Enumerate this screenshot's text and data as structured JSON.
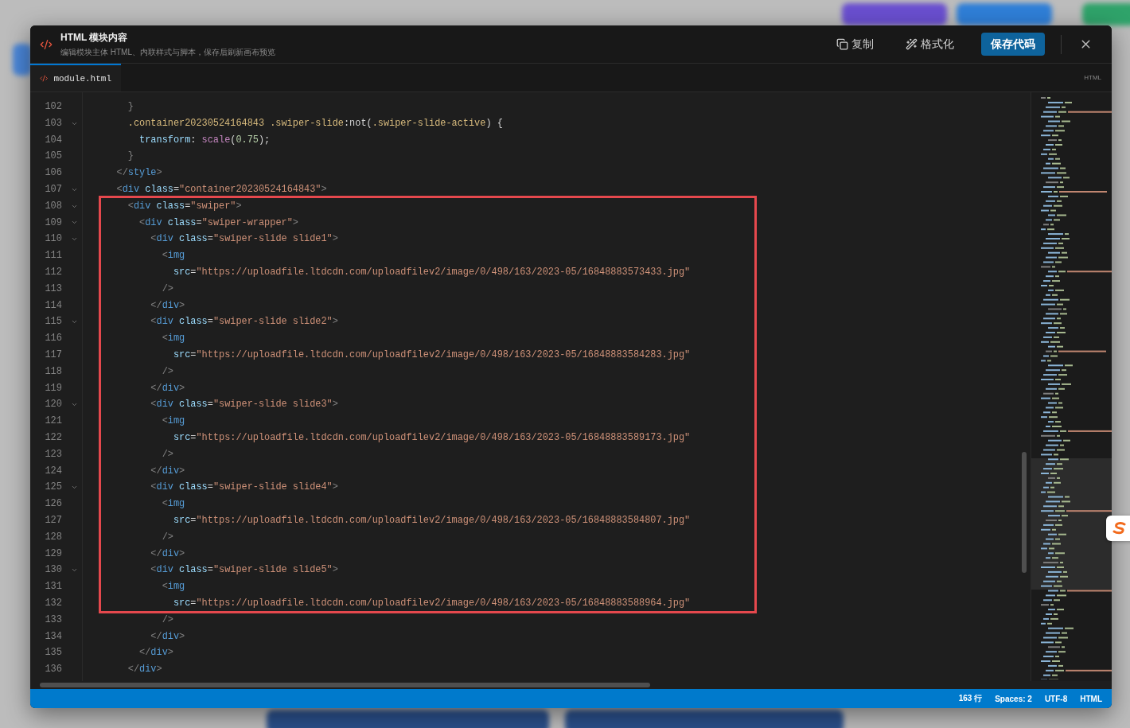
{
  "dialog": {
    "title": "HTML 模块内容",
    "subtitle": "编辑模块主体 HTML、内联样式与脚本，保存后刷新画布预览",
    "actions": [
      {
        "kind": "copy",
        "label": "复制"
      },
      {
        "kind": "format",
        "label": "格式化"
      },
      {
        "kind": "save",
        "label": "保存代码"
      }
    ]
  },
  "tabs": [
    {
      "label": "module.html",
      "selected": true
    }
  ],
  "language_badge": "HTML",
  "lines": [
    {
      "number": "102",
      "foldable": false,
      "tokens": [
        {
          "kind": "punct",
          "text": "      }"
        }
      ]
    },
    {
      "number": "103",
      "foldable": true,
      "tokens": [
        {
          "kind": "selector",
          "text": "      .container20230524164843 .swiper-slide"
        },
        {
          "kind": "text",
          "text": ":not("
        },
        {
          "kind": "selector",
          "text": ".swiper-slide-active"
        },
        {
          "kind": "text",
          "text": ") {"
        }
      ]
    },
    {
      "number": "104",
      "foldable": false,
      "tokens": [
        {
          "kind": "prop",
          "text": "        transform"
        },
        {
          "kind": "text",
          "text": ": "
        },
        {
          "kind": "func",
          "text": "scale"
        },
        {
          "kind": "text",
          "text": "("
        },
        {
          "kind": "num",
          "text": "0.75"
        },
        {
          "kind": "text",
          "text": ");"
        }
      ]
    },
    {
      "number": "105",
      "foldable": false,
      "tokens": [
        {
          "kind": "punct",
          "text": "      }"
        }
      ]
    },
    {
      "number": "106",
      "foldable": false,
      "tokens": [
        {
          "kind": "punct",
          "text": "    </"
        },
        {
          "kind": "tag",
          "text": "style"
        },
        {
          "kind": "punct",
          "text": ">"
        }
      ]
    },
    {
      "number": "107",
      "foldable": true,
      "tokens": [
        {
          "kind": "punct",
          "text": "    <"
        },
        {
          "kind": "tag",
          "text": "div"
        },
        {
          "kind": "attr",
          "text": " class"
        },
        {
          "kind": "text",
          "text": "="
        },
        {
          "kind": "str",
          "text": "\"container20230524164843\""
        },
        {
          "kind": "punct",
          "text": ">"
        }
      ]
    },
    {
      "number": "108",
      "foldable": true,
      "tokens": [
        {
          "kind": "punct",
          "text": "      <"
        },
        {
          "kind": "tag",
          "text": "div"
        },
        {
          "kind": "attr",
          "text": " class"
        },
        {
          "kind": "text",
          "text": "="
        },
        {
          "kind": "str",
          "text": "\"swiper\""
        },
        {
          "kind": "punct",
          "text": ">"
        }
      ]
    },
    {
      "number": "109",
      "foldable": true,
      "tokens": [
        {
          "kind": "punct",
          "text": "        <"
        },
        {
          "kind": "tag",
          "text": "div"
        },
        {
          "kind": "attr",
          "text": " class"
        },
        {
          "kind": "text",
          "text": "="
        },
        {
          "kind": "str",
          "text": "\"swiper-wrapper\""
        },
        {
          "kind": "punct",
          "text": ">"
        }
      ]
    },
    {
      "number": "110",
      "foldable": true,
      "tokens": [
        {
          "kind": "punct",
          "text": "          <"
        },
        {
          "kind": "tag",
          "text": "div"
        },
        {
          "kind": "attr",
          "text": " class"
        },
        {
          "kind": "text",
          "text": "="
        },
        {
          "kind": "str",
          "text": "\"swiper-slide slide1\""
        },
        {
          "kind": "punct",
          "text": ">"
        }
      ]
    },
    {
      "number": "111",
      "foldable": false,
      "tokens": [
        {
          "kind": "punct",
          "text": "            <"
        },
        {
          "kind": "tag",
          "text": "img"
        }
      ]
    },
    {
      "number": "112",
      "foldable": false,
      "tokens": [
        {
          "kind": "attr",
          "text": "              src"
        },
        {
          "kind": "text",
          "text": "="
        },
        {
          "kind": "str",
          "text": "\"https://uploadfile.ltdcdn.com/uploadfilev2/image/0/498/163/2023-05/16848883573433.jpg\""
        }
      ]
    },
    {
      "number": "113",
      "foldable": false,
      "tokens": [
        {
          "kind": "punct",
          "text": "            />"
        }
      ]
    },
    {
      "number": "114",
      "foldable": false,
      "tokens": [
        {
          "kind": "punct",
          "text": "          </"
        },
        {
          "kind": "tag",
          "text": "div"
        },
        {
          "kind": "punct",
          "text": ">"
        }
      ]
    },
    {
      "number": "115",
      "foldable": true,
      "tokens": [
        {
          "kind": "punct",
          "text": "          <"
        },
        {
          "kind": "tag",
          "text": "div"
        },
        {
          "kind": "attr",
          "text": " class"
        },
        {
          "kind": "text",
          "text": "="
        },
        {
          "kind": "str",
          "text": "\"swiper-slide slide2\""
        },
        {
          "kind": "punct",
          "text": ">"
        }
      ]
    },
    {
      "number": "116",
      "foldable": false,
      "tokens": [
        {
          "kind": "punct",
          "text": "            <"
        },
        {
          "kind": "tag",
          "text": "img"
        }
      ]
    },
    {
      "number": "117",
      "foldable": false,
      "tokens": [
        {
          "kind": "attr",
          "text": "              src"
        },
        {
          "kind": "text",
          "text": "="
        },
        {
          "kind": "str",
          "text": "\"https://uploadfile.ltdcdn.com/uploadfilev2/image/0/498/163/2023-05/16848883584283.jpg\""
        }
      ]
    },
    {
      "number": "118",
      "foldable": false,
      "tokens": [
        {
          "kind": "punct",
          "text": "            />"
        }
      ]
    },
    {
      "number": "119",
      "foldable": false,
      "tokens": [
        {
          "kind": "punct",
          "text": "          </"
        },
        {
          "kind": "tag",
          "text": "div"
        },
        {
          "kind": "punct",
          "text": ">"
        }
      ]
    },
    {
      "number": "120",
      "foldable": true,
      "tokens": [
        {
          "kind": "punct",
          "text": "          <"
        },
        {
          "kind": "tag",
          "text": "div"
        },
        {
          "kind": "attr",
          "text": " class"
        },
        {
          "kind": "text",
          "text": "="
        },
        {
          "kind": "str",
          "text": "\"swiper-slide slide3\""
        },
        {
          "kind": "punct",
          "text": ">"
        }
      ]
    },
    {
      "number": "121",
      "foldable": false,
      "tokens": [
        {
          "kind": "punct",
          "text": "            <"
        },
        {
          "kind": "tag",
          "text": "img"
        }
      ]
    },
    {
      "number": "122",
      "foldable": false,
      "tokens": [
        {
          "kind": "attr",
          "text": "              src"
        },
        {
          "kind": "text",
          "text": "="
        },
        {
          "kind": "str",
          "text": "\"https://uploadfile.ltdcdn.com/uploadfilev2/image/0/498/163/2023-05/16848883589173.jpg\""
        }
      ]
    },
    {
      "number": "123",
      "foldable": false,
      "tokens": [
        {
          "kind": "punct",
          "text": "            />"
        }
      ]
    },
    {
      "number": "124",
      "foldable": false,
      "tokens": [
        {
          "kind": "punct",
          "text": "          </"
        },
        {
          "kind": "tag",
          "text": "div"
        },
        {
          "kind": "punct",
          "text": ">"
        }
      ]
    },
    {
      "number": "125",
      "foldable": true,
      "tokens": [
        {
          "kind": "punct",
          "text": "          <"
        },
        {
          "kind": "tag",
          "text": "div"
        },
        {
          "kind": "attr",
          "text": " class"
        },
        {
          "kind": "text",
          "text": "="
        },
        {
          "kind": "str",
          "text": "\"swiper-slide slide4\""
        },
        {
          "kind": "punct",
          "text": ">"
        }
      ]
    },
    {
      "number": "126",
      "foldable": false,
      "tokens": [
        {
          "kind": "punct",
          "text": "            <"
        },
        {
          "kind": "tag",
          "text": "img"
        }
      ]
    },
    {
      "number": "127",
      "foldable": false,
      "tokens": [
        {
          "kind": "attr",
          "text": "              src"
        },
        {
          "kind": "text",
          "text": "="
        },
        {
          "kind": "str",
          "text": "\"https://uploadfile.ltdcdn.com/uploadfilev2/image/0/498/163/2023-05/16848883584807.jpg\""
        }
      ]
    },
    {
      "number": "128",
      "foldable": false,
      "tokens": [
        {
          "kind": "punct",
          "text": "            />"
        }
      ]
    },
    {
      "number": "129",
      "foldable": false,
      "tokens": [
        {
          "kind": "punct",
          "text": "          </"
        },
        {
          "kind": "tag",
          "text": "div"
        },
        {
          "kind": "punct",
          "text": ">"
        }
      ]
    },
    {
      "number": "130",
      "foldable": true,
      "tokens": [
        {
          "kind": "punct",
          "text": "          <"
        },
        {
          "kind": "tag",
          "text": "div"
        },
        {
          "kind": "attr",
          "text": " class"
        },
        {
          "kind": "text",
          "text": "="
        },
        {
          "kind": "str",
          "text": "\"swiper-slide slide5\""
        },
        {
          "kind": "punct",
          "text": ">"
        }
      ]
    },
    {
      "number": "131",
      "foldable": false,
      "tokens": [
        {
          "kind": "punct",
          "text": "            <"
        },
        {
          "kind": "tag",
          "text": "img"
        }
      ]
    },
    {
      "number": "132",
      "foldable": false,
      "tokens": [
        {
          "kind": "attr",
          "text": "              src"
        },
        {
          "kind": "text",
          "text": "="
        },
        {
          "kind": "str",
          "text": "\"https://uploadfile.ltdcdn.com/uploadfilev2/image/0/498/163/2023-05/16848883588964.jpg\""
        }
      ]
    },
    {
      "number": "133",
      "foldable": false,
      "tokens": [
        {
          "kind": "punct",
          "text": "            />"
        }
      ]
    },
    {
      "number": "134",
      "foldable": false,
      "tokens": [
        {
          "kind": "punct",
          "text": "          </"
        },
        {
          "kind": "tag",
          "text": "div"
        },
        {
          "kind": "punct",
          "text": ">"
        }
      ]
    },
    {
      "number": "135",
      "foldable": false,
      "tokens": [
        {
          "kind": "punct",
          "text": "        </"
        },
        {
          "kind": "tag",
          "text": "div"
        },
        {
          "kind": "punct",
          "text": ">"
        }
      ]
    },
    {
      "number": "136",
      "foldable": false,
      "tokens": [
        {
          "kind": "punct",
          "text": "      </"
        },
        {
          "kind": "tag",
          "text": "div"
        },
        {
          "kind": "punct",
          "text": ">"
        }
      ]
    }
  ],
  "status_bar": [
    "163 行",
    "Spaces: 2",
    "UTF-8",
    "HTML"
  ]
}
